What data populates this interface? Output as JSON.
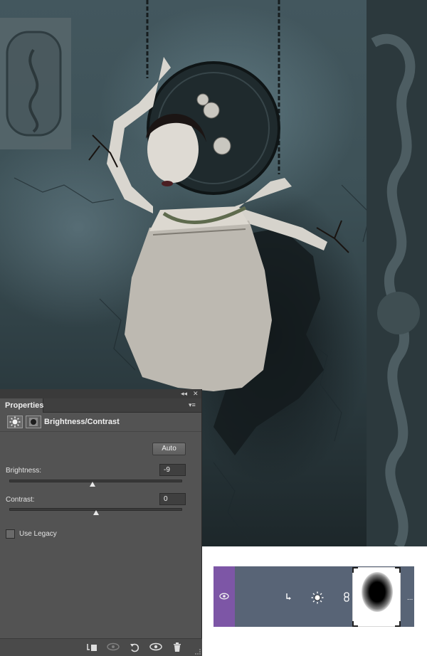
{
  "properties_panel": {
    "tab_label": "Properties",
    "collapse_glyph": "◂◂",
    "close_glyph": "✕",
    "menu_glyph": "▾≡",
    "adjustment_title": "Brightness/Contrast",
    "adjustment_icon": "brightness-icon",
    "mask_icon": "layer-mask-icon",
    "auto_label": "Auto",
    "brightness": {
      "label": "Brightness:",
      "value": "-9",
      "slider_fraction": 0.48
    },
    "contrast": {
      "label": "Contrast:",
      "value": "0",
      "slider_fraction": 0.5
    },
    "use_legacy": {
      "label": "Use Legacy",
      "checked": false
    },
    "footer_icons": [
      "clip-to-layer-icon",
      "view-previous-state-icon",
      "reset-icon",
      "visibility-icon",
      "delete-icon"
    ]
  },
  "layers_strip": {
    "visibility_icon": "eye-icon",
    "clip_icon": "clip-arrow-icon",
    "adjustment_icon": "brightness-icon",
    "link_icon": "chain-link-icon",
    "mask_thumbnail": "mask-thumbnail",
    "more_glyph": "..."
  },
  "colors": {
    "panel_bg": "#535353",
    "layer_row_bg": "#586476",
    "visibility_column": "#7d56a6"
  }
}
